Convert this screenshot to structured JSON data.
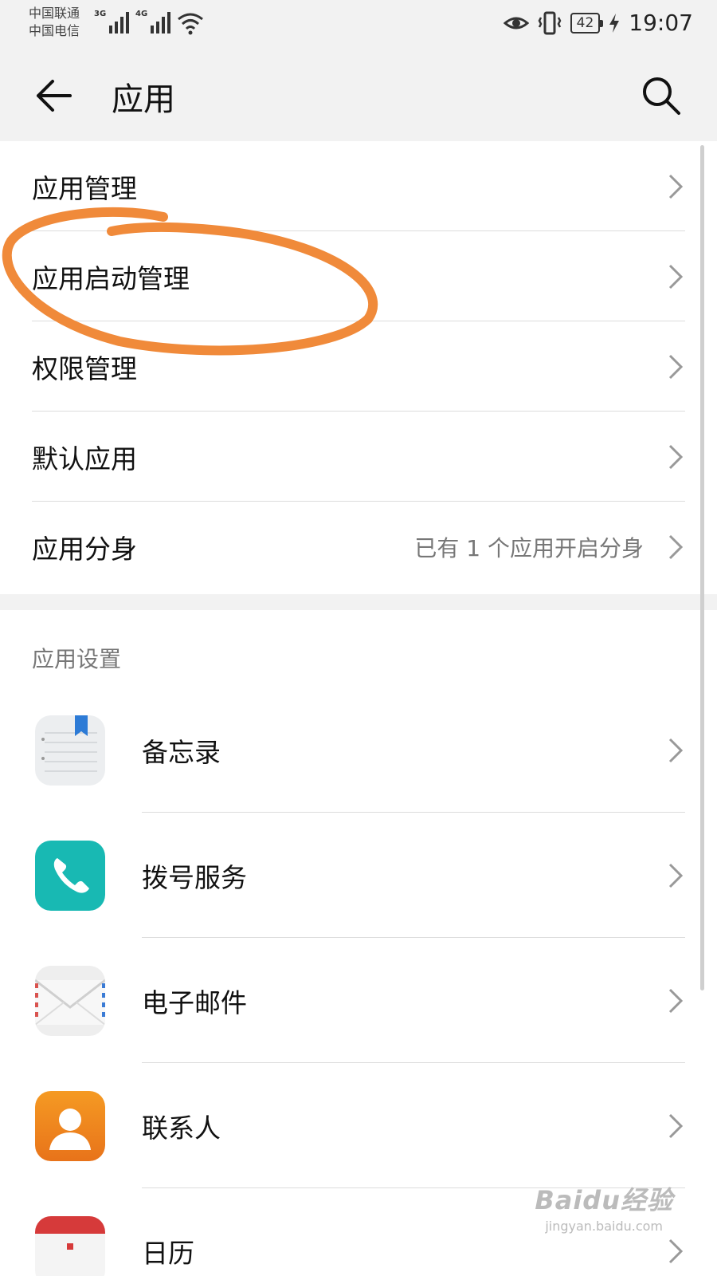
{
  "status_bar": {
    "carrier1": "中国联通",
    "carrier2": "中国电信",
    "network1": "3G",
    "network2": "4G",
    "battery": "42",
    "time": "19:07"
  },
  "app_bar": {
    "title": "应用",
    "back_icon": "arrow-left-icon",
    "search_icon": "search-icon"
  },
  "menu": {
    "items": [
      {
        "label": "应用管理"
      },
      {
        "label": "应用启动管理",
        "highlighted": true
      },
      {
        "label": "权限管理"
      },
      {
        "label": "默认应用"
      },
      {
        "label": "应用分身",
        "value": "已有 1 个应用开启分身"
      }
    ]
  },
  "app_settings": {
    "section_label": "应用设置",
    "apps": [
      {
        "label": "备忘录",
        "icon": "notepad-icon"
      },
      {
        "label": "拨号服务",
        "icon": "phone-icon"
      },
      {
        "label": "电子邮件",
        "icon": "mail-icon"
      },
      {
        "label": "联系人",
        "icon": "contact-icon"
      },
      {
        "label": "日历",
        "icon": "calendar-icon"
      }
    ]
  },
  "annotation": {
    "color": "#f08a3a"
  },
  "watermark": {
    "main": "Baidu经验",
    "sub": "jingyan.baidu.com"
  }
}
